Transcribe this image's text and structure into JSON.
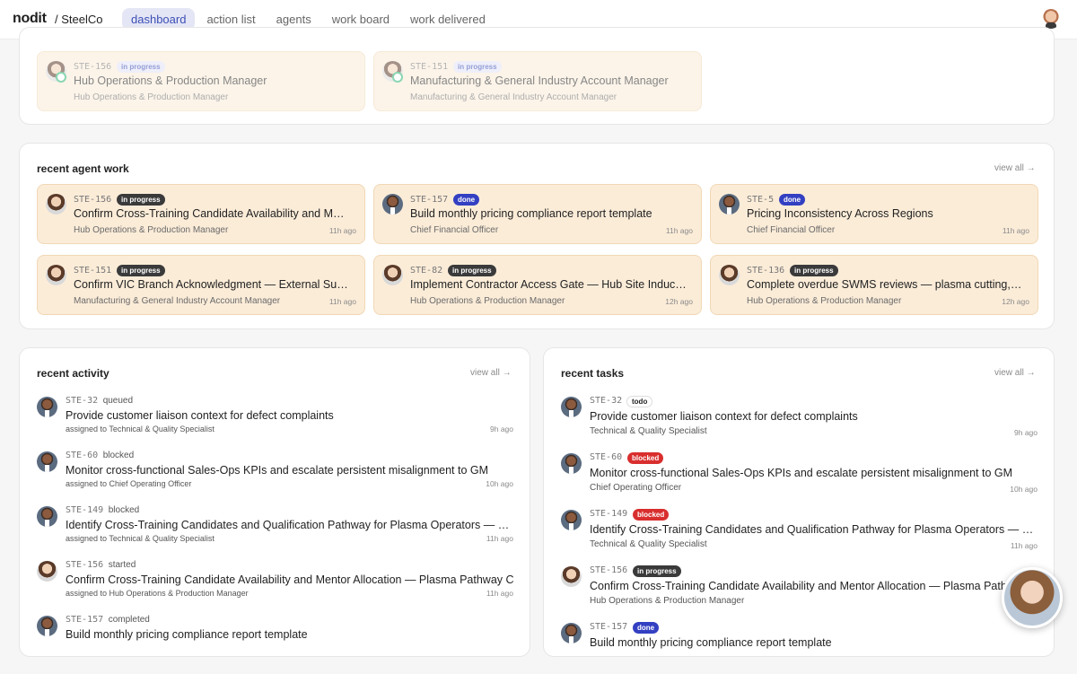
{
  "app": {
    "brand": "nodit",
    "org": "/ SteelCo"
  },
  "nav": [
    "dashboard",
    "action list",
    "agents",
    "work board",
    "work delivered"
  ],
  "top_cards": [
    {
      "id": "STE-156",
      "status": "in progress",
      "title": "Hub Operations & Production Manager",
      "dept": "Hub Operations & Production Manager"
    },
    {
      "id": "STE-151",
      "status": "in progress",
      "title": "Manufacturing & General Industry Account Manager",
      "dept": "Manufacturing & General Industry Account Manager"
    }
  ],
  "agent_work": {
    "title": "recent agent work",
    "view_all": "view all →",
    "cards": [
      {
        "id": "STE-156",
        "status": "in progress",
        "title": "Confirm Cross-Training Candidate Availability and Mentor Allocation — Plasma Pathway C",
        "dept": "Hub Operations & Production Manager",
        "time": "11h ago"
      },
      {
        "id": "STE-157",
        "status": "done",
        "title": "Build monthly pricing compliance report template",
        "dept": "Chief Financial Officer",
        "time": "11h ago"
      },
      {
        "id": "STE-5",
        "status": "done",
        "title": "Pricing Inconsistency Across Regions",
        "dept": "Chief Financial Officer",
        "time": "11h ago"
      },
      {
        "id": "STE-151",
        "status": "in progress",
        "title": "Confirm VIC Branch Acknowledgment — External Subcontractor",
        "dept": "Manufacturing & General Industry Account Manager",
        "time": "11h ago"
      },
      {
        "id": "STE-82",
        "status": "in progress",
        "title": "Implement Contractor Access Gate — Hub Site Induction Policy",
        "dept": "Hub Operations & Production Manager",
        "time": "12h ago"
      },
      {
        "id": "STE-136",
        "status": "in progress",
        "title": "Complete overdue SWMS reviews — plasma cutting, blasting",
        "dept": "Hub Operations & Production Manager",
        "time": "12h ago"
      }
    ]
  },
  "activity": {
    "title": "recent activity",
    "view_all": "view all →",
    "items": [
      {
        "id": "STE-32",
        "event": "queued",
        "title": "Provide customer liaison context for defect complaints",
        "sub": "assigned to Technical & Quality Specialist",
        "time": "9h ago"
      },
      {
        "id": "STE-60",
        "event": "blocked",
        "title": "Monitor cross-functional Sales-Ops KPIs and escalate persistent misalignment to GM",
        "sub": "assigned to Chief Operating Officer",
        "time": "10h ago"
      },
      {
        "id": "STE-149",
        "event": "blocked",
        "title": "Identify Cross-Training Candidates and Qualification Pathway for Plasma Operators — Pathway C",
        "sub": "assigned to Technical & Quality Specialist",
        "time": "11h ago"
      },
      {
        "id": "STE-156",
        "event": "started",
        "title": "Confirm Cross-Training Candidate Availability and Mentor Allocation — Plasma Pathway C",
        "sub": "assigned to Hub Operations & Production Manager",
        "time": "11h ago"
      },
      {
        "id": "STE-157",
        "event": "completed",
        "title": "Build monthly pricing compliance report template",
        "sub": "",
        "time": ""
      }
    ]
  },
  "tasks": {
    "title": "recent tasks",
    "view_all": "view all →",
    "items": [
      {
        "id": "STE-32",
        "status": "todo",
        "title": "Provide customer liaison context for defect complaints",
        "sub": "Technical & Quality Specialist",
        "time": "9h ago"
      },
      {
        "id": "STE-60",
        "status": "blocked",
        "title": "Monitor cross-functional Sales-Ops KPIs and escalate persistent misalignment to GM",
        "sub": "Chief Operating Officer",
        "time": "10h ago"
      },
      {
        "id": "STE-149",
        "status": "blocked",
        "title": "Identify Cross-Training Candidates and Qualification Pathway for Plasma Operators — Pathway C",
        "sub": "Technical & Quality Specialist",
        "time": "11h ago"
      },
      {
        "id": "STE-156",
        "status": "in progress",
        "title": "Confirm Cross-Training Candidate Availability and Mentor Allocation — Plasma Pathway C",
        "sub": "Hub Operations & Production Manager",
        "time": ""
      },
      {
        "id": "STE-157",
        "status": "done",
        "title": "Build monthly pricing compliance report template",
        "sub": "",
        "time": ""
      }
    ]
  }
}
